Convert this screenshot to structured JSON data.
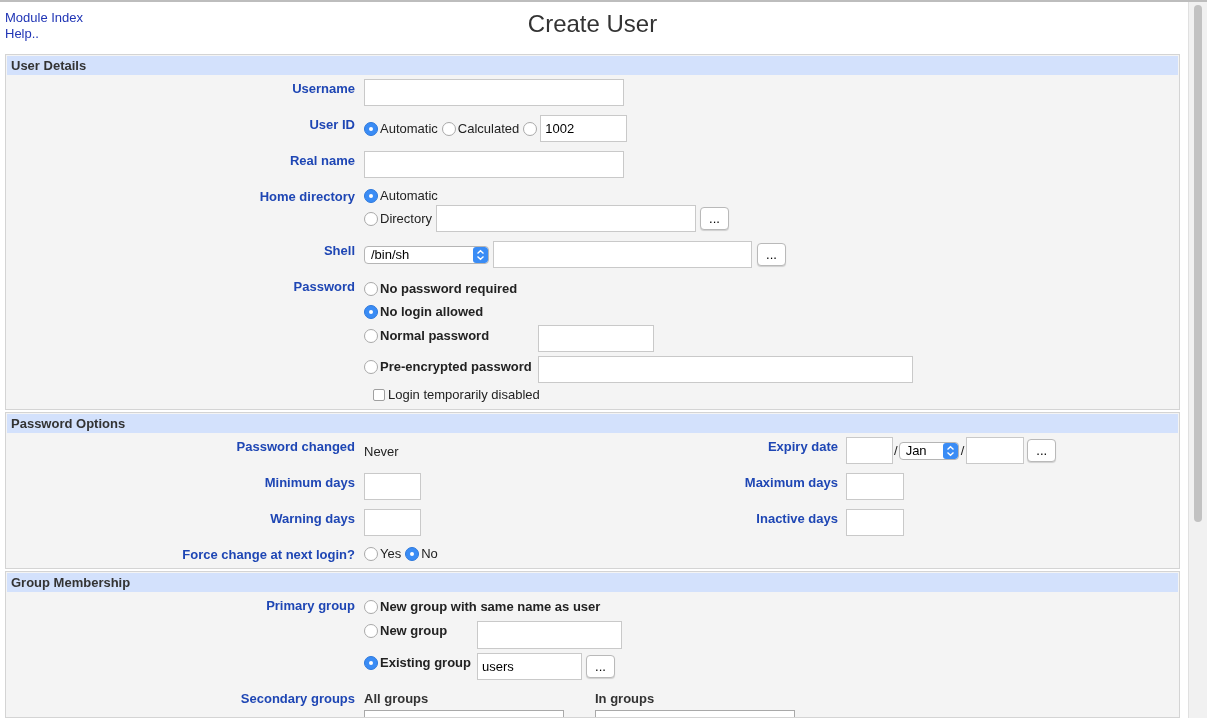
{
  "header": {
    "links": [
      {
        "label": "Module Index"
      },
      {
        "label": "Help.."
      }
    ],
    "title": "Create User"
  },
  "user_details": {
    "title": "User Details",
    "username": {
      "label": "Username"
    },
    "user_id": {
      "label": "User ID",
      "options": [
        {
          "kind": "label",
          "label": "Automatic",
          "selected": true
        },
        {
          "kind": "label",
          "label": "Calculated",
          "selected": false
        },
        {
          "kind": "input",
          "value": "1002",
          "selected": false
        }
      ]
    },
    "real_name": {
      "label": "Real name"
    },
    "home_directory": {
      "label": "Home directory",
      "options": [
        {
          "kind": "label",
          "label": "Automatic",
          "selected": true
        },
        {
          "kind": "input_button",
          "label": "Directory",
          "button": "...",
          "selected": false
        }
      ]
    },
    "shell": {
      "label": "Shell",
      "value": "/bin/sh",
      "button": "..."
    },
    "password": {
      "label": "Password",
      "options": [
        {
          "kind": "label",
          "label": "No password required",
          "selected": false
        },
        {
          "kind": "label",
          "label": "No login allowed",
          "selected": true
        },
        {
          "kind": "short_input",
          "label": "Normal password",
          "selected": false
        },
        {
          "kind": "long_input",
          "label": "Pre-encrypted password",
          "selected": false
        }
      ],
      "disabled_option": {
        "label": "Login temporarily disabled",
        "checked": false
      }
    }
  },
  "password_options": {
    "title": "Password Options",
    "password_changed": {
      "label": "Password changed",
      "value": "Never"
    },
    "expiry_date": {
      "label": "Expiry date",
      "separators": [
        "/",
        "/"
      ],
      "month": "Jan",
      "button": "..."
    },
    "minimum_days": {
      "label": "Minimum days"
    },
    "maximum_days": {
      "label": "Maximum days"
    },
    "warning_days": {
      "label": "Warning days"
    },
    "inactive_days": {
      "label": "Inactive days"
    },
    "force_change": {
      "label": "Force change at next login?",
      "options": [
        {
          "label": "Yes",
          "selected": false
        },
        {
          "label": "No",
          "selected": true
        }
      ]
    }
  },
  "group_membership": {
    "title": "Group Membership",
    "primary_group": {
      "label": "Primary group",
      "options": [
        {
          "kind": "label",
          "label": "New group with same name as user",
          "selected": false
        },
        {
          "kind": "input",
          "label": "New group",
          "selected": false
        },
        {
          "kind": "input_button",
          "label": "Existing group",
          "value": "users",
          "button": "...",
          "selected": true
        }
      ]
    },
    "secondary_groups": {
      "label": "Secondary groups",
      "lists": [
        {
          "title": "All groups"
        },
        {
          "title": "In groups"
        }
      ]
    }
  }
}
